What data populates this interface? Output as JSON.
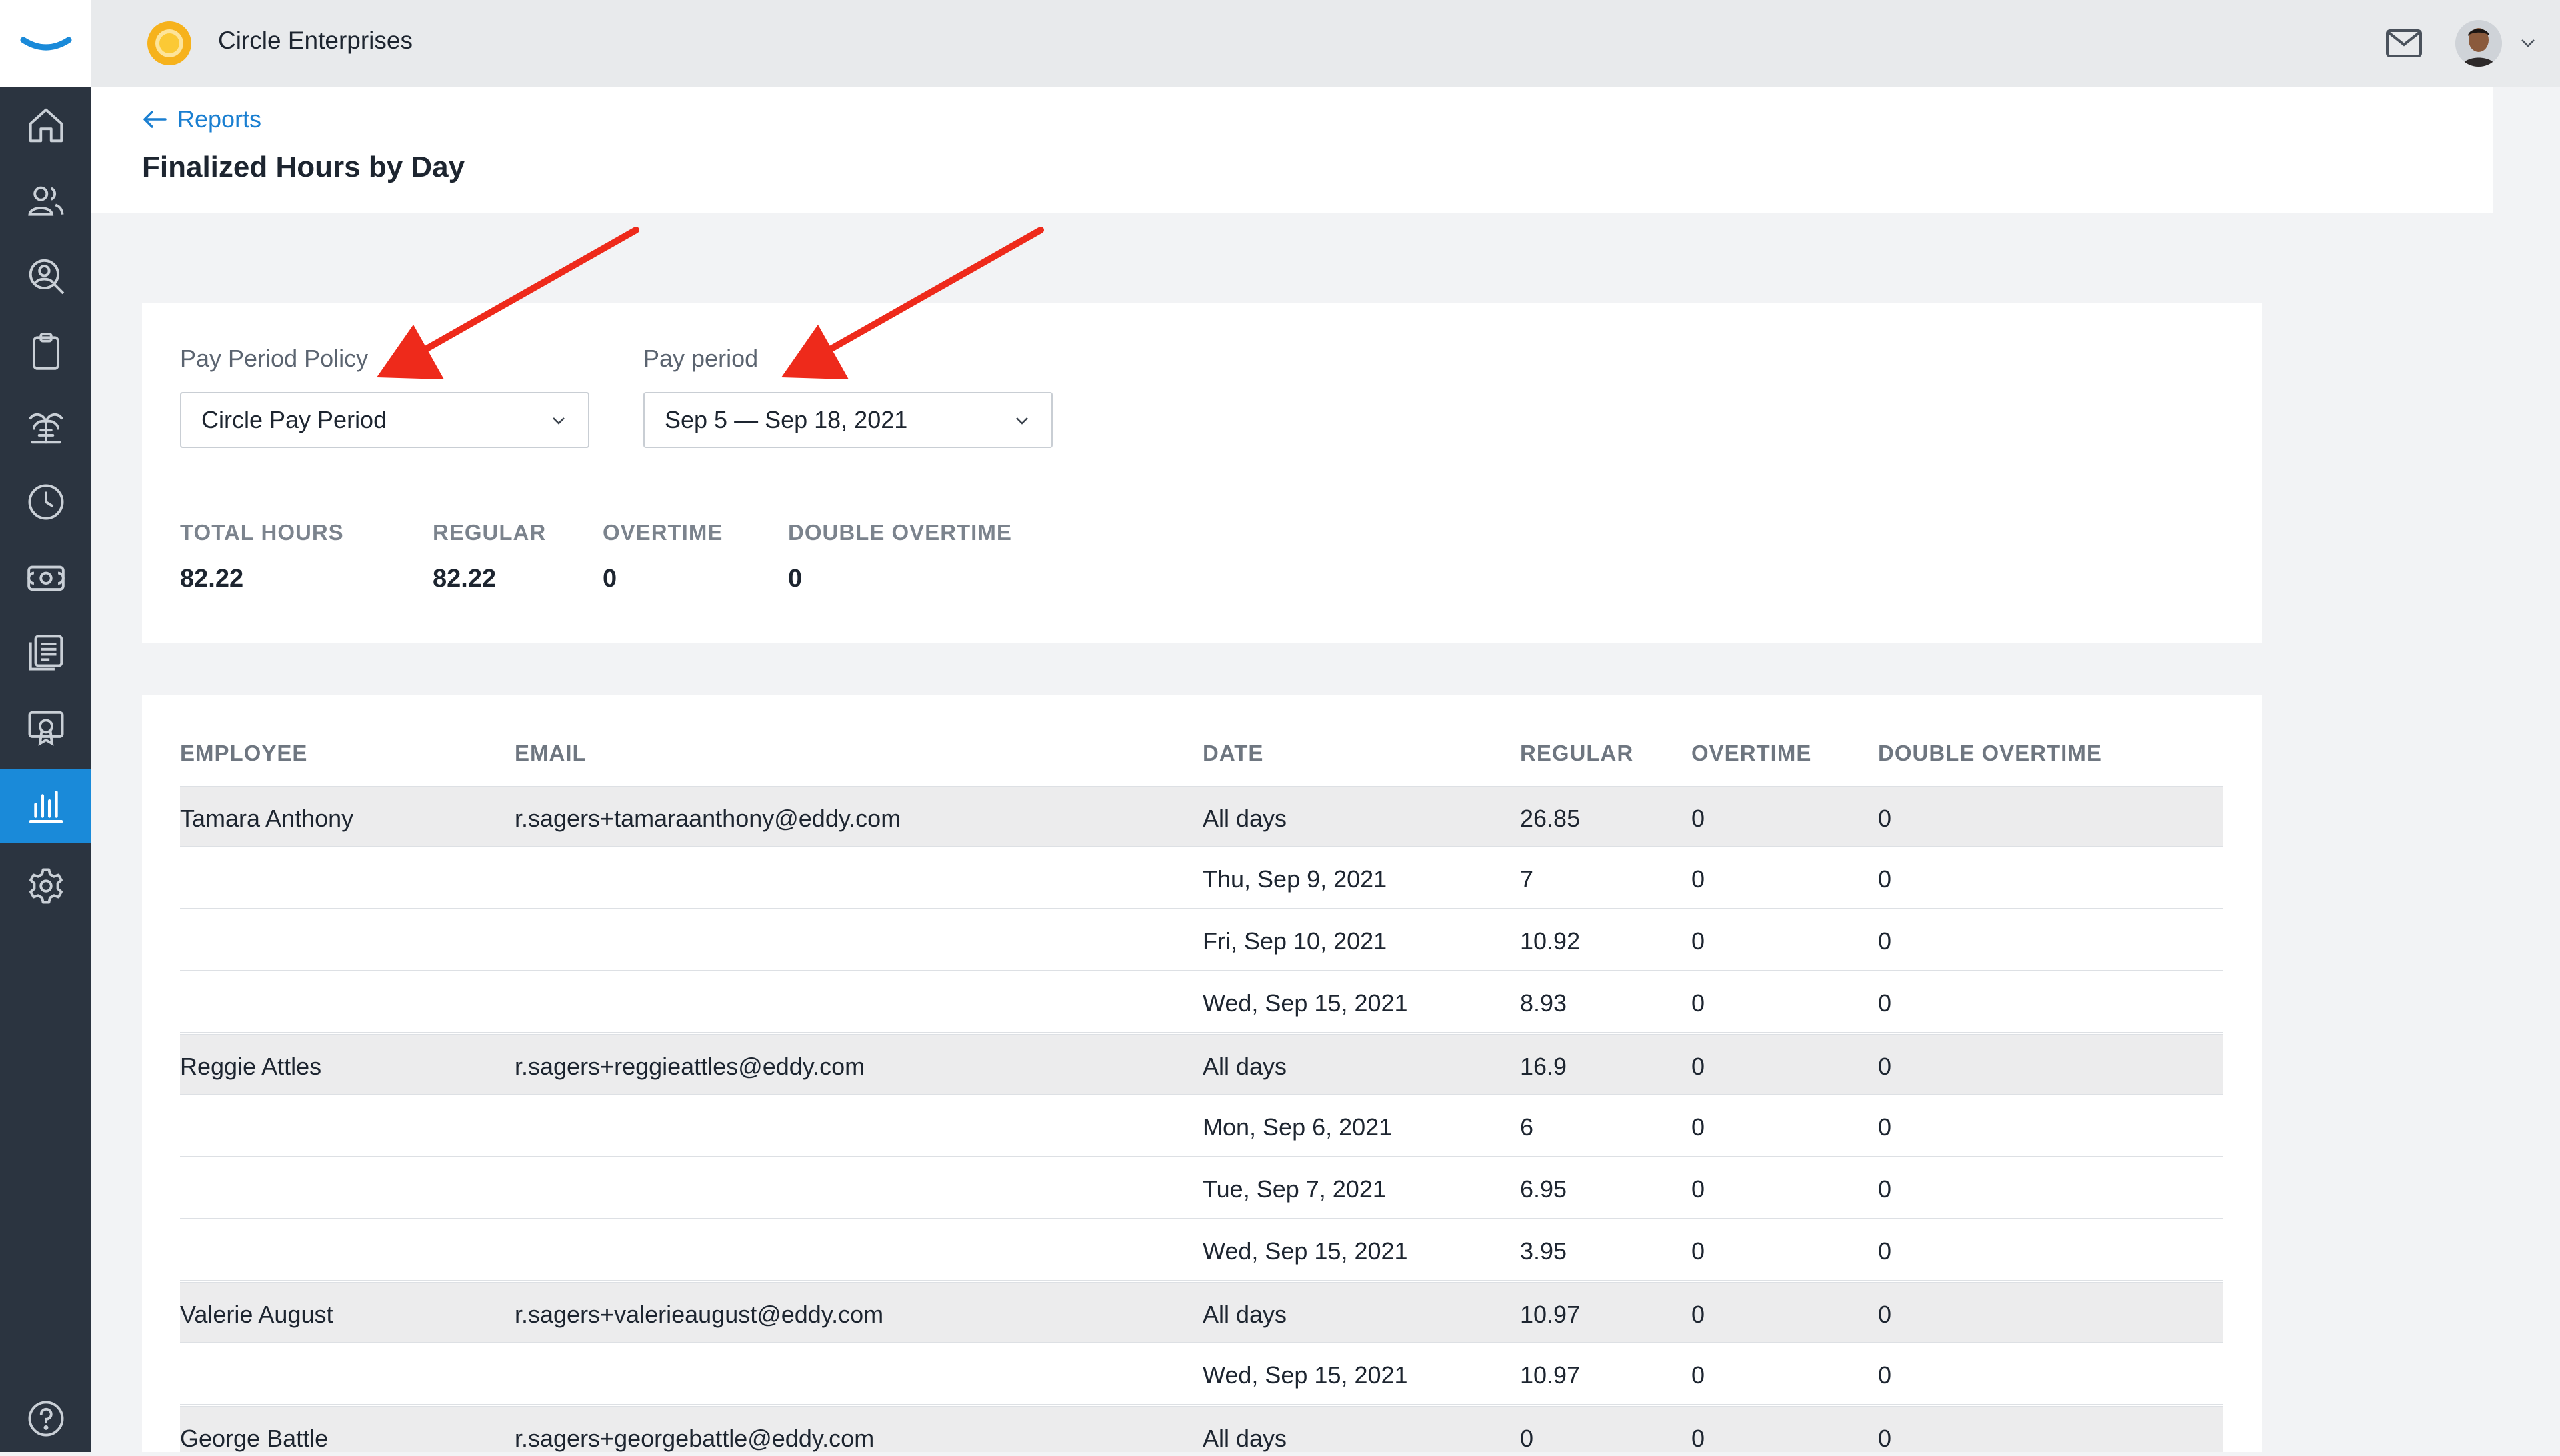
{
  "app": {
    "org_name": "Circle Enterprises",
    "accent_color": "#1a8ad9"
  },
  "sidebar": {
    "items": [
      {
        "icon": "home-icon",
        "active": false
      },
      {
        "icon": "people-icon",
        "active": false
      },
      {
        "icon": "user-search-icon",
        "active": false
      },
      {
        "icon": "clipboard-icon",
        "active": false
      },
      {
        "icon": "palm-tree-icon",
        "active": false
      },
      {
        "icon": "clock-icon",
        "active": false
      },
      {
        "icon": "money-icon",
        "active": false
      },
      {
        "icon": "documents-icon",
        "active": false
      },
      {
        "icon": "certificate-icon",
        "active": false
      },
      {
        "icon": "bar-chart-icon",
        "active": true
      },
      {
        "icon": "gear-icon",
        "active": false
      }
    ],
    "help_icon": "help-icon"
  },
  "header": {
    "back_label": "Reports",
    "title": "Finalized Hours by Day"
  },
  "filters": {
    "policy_label": "Pay Period Policy",
    "policy_value": "Circle Pay Period",
    "period_label": "Pay period",
    "period_value": "Sep 5 — Sep 18, 2021"
  },
  "stats": [
    {
      "label": "TOTAL HOURS",
      "value": "82.22"
    },
    {
      "label": "REGULAR",
      "value": "82.22"
    },
    {
      "label": "OVERTIME",
      "value": "0"
    },
    {
      "label": "DOUBLE OVERTIME",
      "value": "0"
    }
  ],
  "table": {
    "columns": [
      "EMPLOYEE",
      "EMAIL",
      "DATE",
      "REGULAR",
      "OVERTIME",
      "DOUBLE OVERTIME"
    ],
    "rows": [
      {
        "employee": "Tamara Anthony",
        "email": "r.sagers+tamaraanthony@eddy.com",
        "date": "All days",
        "regular": "26.85",
        "overtime": "0",
        "double_overtime": "0",
        "summary": true
      },
      {
        "employee": "",
        "email": "",
        "date": "Thu, Sep 9, 2021",
        "regular": "7",
        "overtime": "0",
        "double_overtime": "0",
        "summary": false
      },
      {
        "employee": "",
        "email": "",
        "date": "Fri, Sep 10, 2021",
        "regular": "10.92",
        "overtime": "0",
        "double_overtime": "0",
        "summary": false
      },
      {
        "employee": "",
        "email": "",
        "date": "Wed, Sep 15, 2021",
        "regular": "8.93",
        "overtime": "0",
        "double_overtime": "0",
        "summary": false
      },
      {
        "employee": "Reggie Attles",
        "email": "r.sagers+reggieattles@eddy.com",
        "date": "All days",
        "regular": "16.9",
        "overtime": "0",
        "double_overtime": "0",
        "summary": true
      },
      {
        "employee": "",
        "email": "",
        "date": "Mon, Sep 6, 2021",
        "regular": "6",
        "overtime": "0",
        "double_overtime": "0",
        "summary": false
      },
      {
        "employee": "",
        "email": "",
        "date": "Tue, Sep 7, 2021",
        "regular": "6.95",
        "overtime": "0",
        "double_overtime": "0",
        "summary": false
      },
      {
        "employee": "",
        "email": "",
        "date": "Wed, Sep 15, 2021",
        "regular": "3.95",
        "overtime": "0",
        "double_overtime": "0",
        "summary": false
      },
      {
        "employee": "Valerie August",
        "email": "r.sagers+valerieaugust@eddy.com",
        "date": "All days",
        "regular": "10.97",
        "overtime": "0",
        "double_overtime": "0",
        "summary": true
      },
      {
        "employee": "",
        "email": "",
        "date": "Wed, Sep 15, 2021",
        "regular": "10.97",
        "overtime": "0",
        "double_overtime": "0",
        "summary": false
      },
      {
        "employee": "George Battle",
        "email": "r.sagers+georgebattle@eddy.com",
        "date": "All days",
        "regular": "0",
        "overtime": "0",
        "double_overtime": "0",
        "summary": true
      }
    ]
  },
  "annotations": {
    "arrow_color": "#ee2a1b"
  }
}
